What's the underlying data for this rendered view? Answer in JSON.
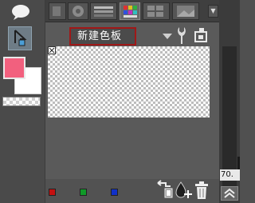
{
  "color_set": {
    "name": "新建色板"
  },
  "status": {
    "zoom": "70."
  },
  "swatches": {
    "foreground": "#f2607e",
    "background": "#ffffff"
  },
  "bottom_colors": [
    "#c41010",
    "#109a28",
    "#1030c8"
  ],
  "icons": {
    "speech_bubble": "speech-bubble-icon",
    "selection": "selection-arrow-icon",
    "tab_1": "hand-icon",
    "tab_2": "gradient-bars-icon",
    "tab_3": "color-set-icon",
    "tab_4": "grid-icon",
    "tab_5": "image-icon",
    "settings": "wrench-icon",
    "swap": "color-swap-icon",
    "add": "add-color-icon",
    "delete": "trash-icon",
    "scroll_up": "scroll-up-icon"
  }
}
